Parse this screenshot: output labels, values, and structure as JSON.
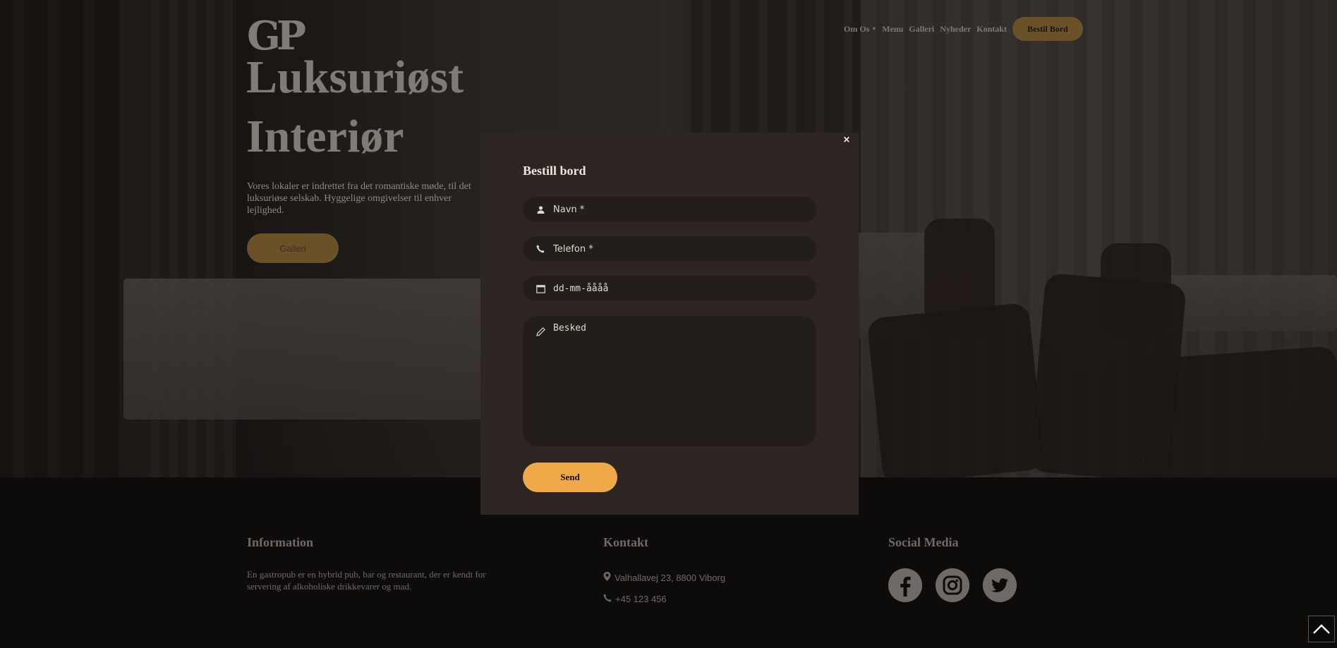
{
  "brand": {
    "logo_text": "GP"
  },
  "nav": {
    "items": [
      {
        "label": "Om Os",
        "has_dropdown": true
      },
      {
        "label": "Menu"
      },
      {
        "label": "Galleri"
      },
      {
        "label": "Nyheder"
      },
      {
        "label": "Kontakt"
      }
    ],
    "cta_label": "Bestil Bord"
  },
  "hero": {
    "title_line1": "Luksuriøst",
    "title_line2": "Interiør",
    "text": "Vores lokaler er indrettet fra det romantiske møde, til det luksuriøse selskab. Hyggelige omgivelser til enhver lejlighed.",
    "button_label": "Galleri"
  },
  "modal": {
    "close_label": "×",
    "title": "Bestill bord",
    "fields": {
      "name_placeholder": "Navn *",
      "phone_placeholder": "Telefon *",
      "date_placeholder": "dd-mm-åååå",
      "message_placeholder": "Besked"
    },
    "submit_label": "Send"
  },
  "footer": {
    "information": {
      "heading": "Information",
      "text": "En gastropub er en hybrid pub, bar og restaurant, der er kendt for servering af alkoholiske drikkevarer og mad."
    },
    "kontakt": {
      "heading": "Kontakt",
      "address": "Valhallavej 23, 8800 Viborg",
      "phone": "+45 123 456"
    },
    "social": {
      "heading": "Social Media",
      "icons": [
        "facebook-icon",
        "instagram-icon",
        "twitter-icon"
      ]
    }
  },
  "colors": {
    "accent": "#f0a949",
    "modal_bg": "#2c2521",
    "field_bg": "#241e1b",
    "footer_bg": "#0d0c0b"
  }
}
